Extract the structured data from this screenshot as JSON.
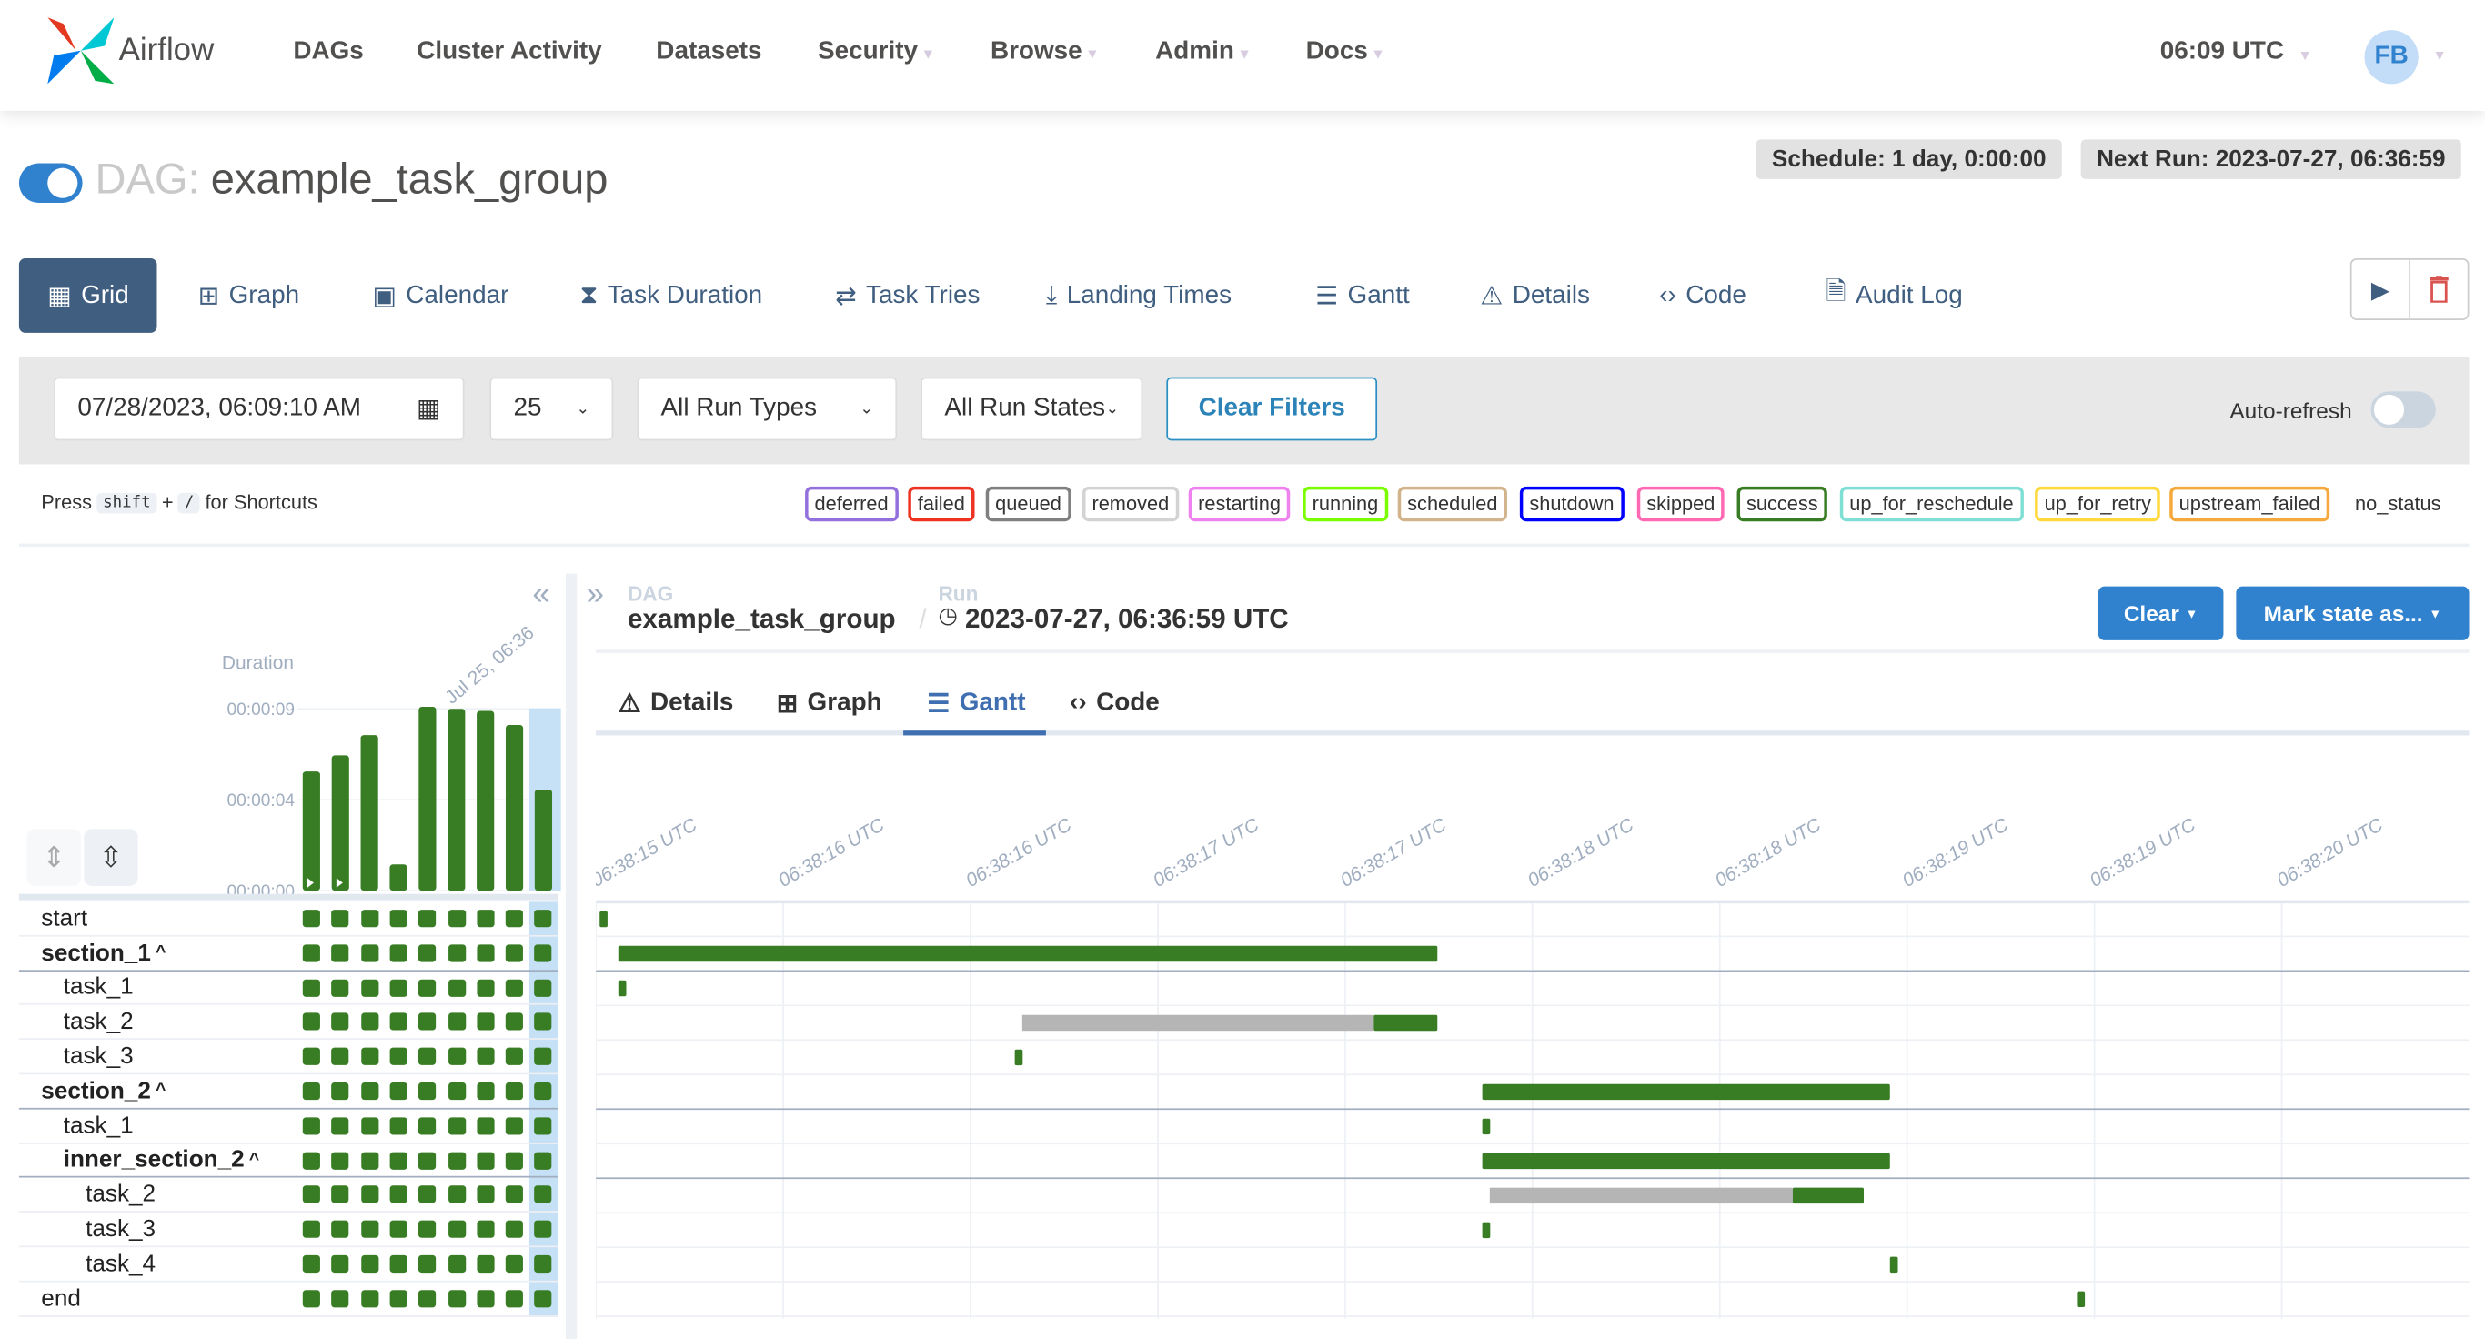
{
  "app": {
    "name": "Airflow"
  },
  "nav": {
    "items": [
      {
        "label": "DAGs",
        "dropdown": false
      },
      {
        "label": "Cluster Activity",
        "dropdown": false
      },
      {
        "label": "Datasets",
        "dropdown": false
      },
      {
        "label": "Security",
        "dropdown": true
      },
      {
        "label": "Browse",
        "dropdown": true
      },
      {
        "label": "Admin",
        "dropdown": true
      },
      {
        "label": "Docs",
        "dropdown": true
      }
    ],
    "clock": "06:09 UTC",
    "avatar": "FB"
  },
  "dag": {
    "prefix": "DAG:",
    "id": "example_task_group",
    "paused": false,
    "schedule": "Schedule: 1 day, 0:00:00",
    "next_run": "Next Run: 2023-07-27, 06:36:59"
  },
  "views": [
    {
      "label": "Grid",
      "icon": "grid-icon",
      "active": true
    },
    {
      "label": "Graph",
      "icon": "graph-icon"
    },
    {
      "label": "Calendar",
      "icon": "calendar-icon"
    },
    {
      "label": "Task Duration",
      "icon": "hourglass-icon"
    },
    {
      "label": "Task Tries",
      "icon": "retry-icon"
    },
    {
      "label": "Landing Times",
      "icon": "landing-icon"
    },
    {
      "label": "Gantt",
      "icon": "gantt-icon"
    },
    {
      "label": "Details",
      "icon": "warning-triangle-icon"
    },
    {
      "label": "Code",
      "icon": "code-icon"
    },
    {
      "label": "Audit Log",
      "icon": "audit-log-icon"
    }
  ],
  "filters": {
    "date": "07/28/2023, 06:09:10 AM",
    "num_runs": "25",
    "run_type": "All Run Types",
    "run_state": "All Run States",
    "clear": "Clear Filters",
    "auto_refresh": "Auto-refresh",
    "auto_refresh_on": false
  },
  "shortcuts": {
    "press": "Press",
    "key1": "shift",
    "plus": "+",
    "key2": "/",
    "suffix": "for Shortcuts"
  },
  "legend": [
    {
      "label": "deferred",
      "color": "#9370db"
    },
    {
      "label": "failed",
      "color": "#ee3322"
    },
    {
      "label": "queued",
      "color": "#808080"
    },
    {
      "label": "removed",
      "color": "#d3d3d3"
    },
    {
      "label": "restarting",
      "color": "#ee82ee"
    },
    {
      "label": "running",
      "color": "#7cfc00"
    },
    {
      "label": "scheduled",
      "color": "#d2b48c"
    },
    {
      "label": "shutdown",
      "color": "#0000ff"
    },
    {
      "label": "skipped",
      "color": "#ff69b4"
    },
    {
      "label": "success",
      "color": "#387d24"
    },
    {
      "label": "up_for_reschedule",
      "color": "#7fdfd4"
    },
    {
      "label": "up_for_retry",
      "color": "#ffd93d"
    },
    {
      "label": "upstream_failed",
      "color": "#f5a83b"
    },
    {
      "label": "no_status",
      "color": ""
    }
  ],
  "grid": {
    "duration_label": "Duration",
    "run_label": "Jul 25, 06:36",
    "selected_run": 9,
    "rows": [
      {
        "label": "start",
        "level": 0
      },
      {
        "label": "section_1",
        "level": 0,
        "group": true
      },
      {
        "label": "task_1",
        "level": 1
      },
      {
        "label": "task_2",
        "level": 1
      },
      {
        "label": "task_3",
        "level": 1
      },
      {
        "label": "section_2",
        "level": 0,
        "group": true
      },
      {
        "label": "task_1",
        "level": 1
      },
      {
        "label": "inner_section_2",
        "level": 1,
        "group": true
      },
      {
        "label": "task_2",
        "level": 2
      },
      {
        "label": "task_3",
        "level": 2
      },
      {
        "label": "task_4",
        "level": 2
      },
      {
        "label": "end",
        "level": 0
      }
    ]
  },
  "chart_data": [
    {
      "type": "bar",
      "ylabel": "Duration",
      "yticks": [
        "00:00:00",
        "00:00:04",
        "00:00:09"
      ],
      "ylim": [
        0,
        9.2
      ],
      "values_seconds": [
        5.9,
        6.7,
        7.7,
        1.3,
        9.1,
        9.0,
        8.9,
        8.2,
        5.0
      ],
      "manual_trigger": [
        true,
        true,
        false,
        false,
        false,
        false,
        false,
        false,
        false
      ],
      "color": "#387d24"
    },
    {
      "type": "gantt",
      "xticks": [
        "06:38:15 UTC",
        "06:38:16 UTC",
        "06:38:16 UTC",
        "06:38:17 UTC",
        "06:38:17 UTC",
        "06:38:18 UTC",
        "06:38:18 UTC",
        "06:38:19 UTC",
        "06:38:19 UTC",
        "06:38:20 UTC"
      ],
      "xlim": [
        "06:38:15.0",
        "06:38:20.0"
      ],
      "bars": [
        {
          "task": "start",
          "start": "06:38:15.01",
          "end": "06:38:15.03"
        },
        {
          "task": "section_1",
          "start": "06:38:15.06",
          "end": "06:38:17.25"
        },
        {
          "task": "section_1.task_1",
          "start": "06:38:15.06",
          "end": "06:38:15.08"
        },
        {
          "task": "section_1.task_2",
          "queued": "06:38:16.14",
          "start": "06:38:17.08",
          "end": "06:38:17.25"
        },
        {
          "task": "section_1.task_3",
          "start": "06:38:16.12",
          "end": "06:38:16.14"
        },
        {
          "task": "section_2",
          "start": "06:38:17.37",
          "end": "06:38:18.46"
        },
        {
          "task": "section_2.task_1",
          "start": "06:38:17.37",
          "end": "06:38:17.39"
        },
        {
          "task": "inner_section_2",
          "start": "06:38:17.37",
          "end": "06:38:18.46"
        },
        {
          "task": "inner_section_2.task_2",
          "queued": "06:38:17.39",
          "start": "06:38:18.20",
          "end": "06:38:18.39"
        },
        {
          "task": "inner_section_2.task_3",
          "start": "06:38:17.37",
          "end": "06:38:17.39"
        },
        {
          "task": "inner_section_2.task_4",
          "start": "06:38:18.46",
          "end": "06:38:18.48"
        },
        {
          "task": "end",
          "start": "06:38:18.96",
          "end": "06:38:18.98"
        }
      ]
    }
  ],
  "panel": {
    "dag_label": "DAG",
    "dag_id": "example_task_group",
    "run_label": "Run",
    "run_id": "2023-07-27, 06:36:59 UTC",
    "clear": "Clear",
    "mark_state": "Mark state as...",
    "tabs": [
      {
        "label": "Details",
        "icon": "warning-triangle-icon"
      },
      {
        "label": "Graph",
        "icon": "graph-icon"
      },
      {
        "label": "Gantt",
        "icon": "gantt-icon",
        "active": true
      },
      {
        "label": "Code",
        "icon": "code-icon"
      }
    ]
  },
  "colors": {
    "success": "#387d24",
    "queued": "#b5b5b5",
    "primary": "#3f5e80",
    "accent": "#3182ce"
  }
}
